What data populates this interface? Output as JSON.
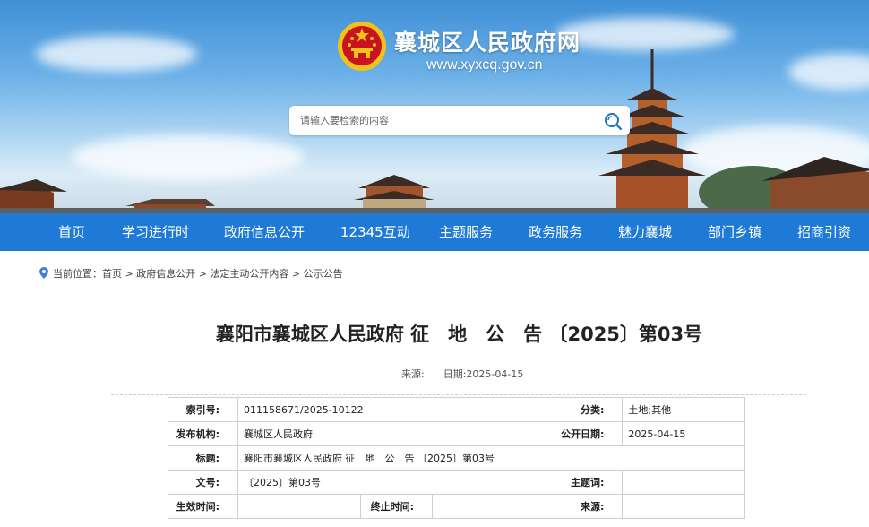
{
  "header": {
    "site_title": "襄城区人民政府网",
    "site_url": "www.xyxcq.gov.cn",
    "search_placeholder": "请输入要检索的内容"
  },
  "nav": {
    "items": [
      {
        "label": "首页"
      },
      {
        "label": "学习进行时"
      },
      {
        "label": "政府信息公开"
      },
      {
        "label": "12345互动"
      },
      {
        "label": "主题服务"
      },
      {
        "label": "政务服务"
      },
      {
        "label": "魅力襄城"
      },
      {
        "label": "部门乡镇"
      },
      {
        "label": "招商引资"
      }
    ]
  },
  "breadcrumb": {
    "prefix": "当前位置：",
    "items": [
      "首页",
      "政府信息公开",
      "法定主动公开内容",
      "公示公告"
    ],
    "separator": " > "
  },
  "article": {
    "title": "襄阳市襄城区人民政府 征　地　公　告 〔2025〕第03号",
    "source_label": "来源:",
    "date_label": "日期:",
    "date": "2025-04-15"
  },
  "info_table": {
    "index_label": "索引号:",
    "index_value": "011158671/2025-10122",
    "category_label": "分类:",
    "category_value": "土地;其他",
    "publisher_label": "发布机构:",
    "publisher_value": "襄城区人民政府",
    "pub_date_label": "公开日期:",
    "pub_date_value": "2025-04-15",
    "title_label": "标题:",
    "title_value": "襄阳市襄城区人民政府 征　地　公　告 〔2025〕第03号",
    "doc_no_label": "文号:",
    "doc_no_value": "〔2025〕第03号",
    "subject_label": "主题词:",
    "subject_value": "",
    "effective_label": "生效时间:",
    "effective_value": "",
    "expire_label": "终止时间:",
    "expire_value": "",
    "source_label": "来源:",
    "source_value": ""
  },
  "colors": {
    "nav_bg": "#1e7ad6",
    "emblem_red": "#c8141e",
    "emblem_gold": "#f2c21a"
  }
}
